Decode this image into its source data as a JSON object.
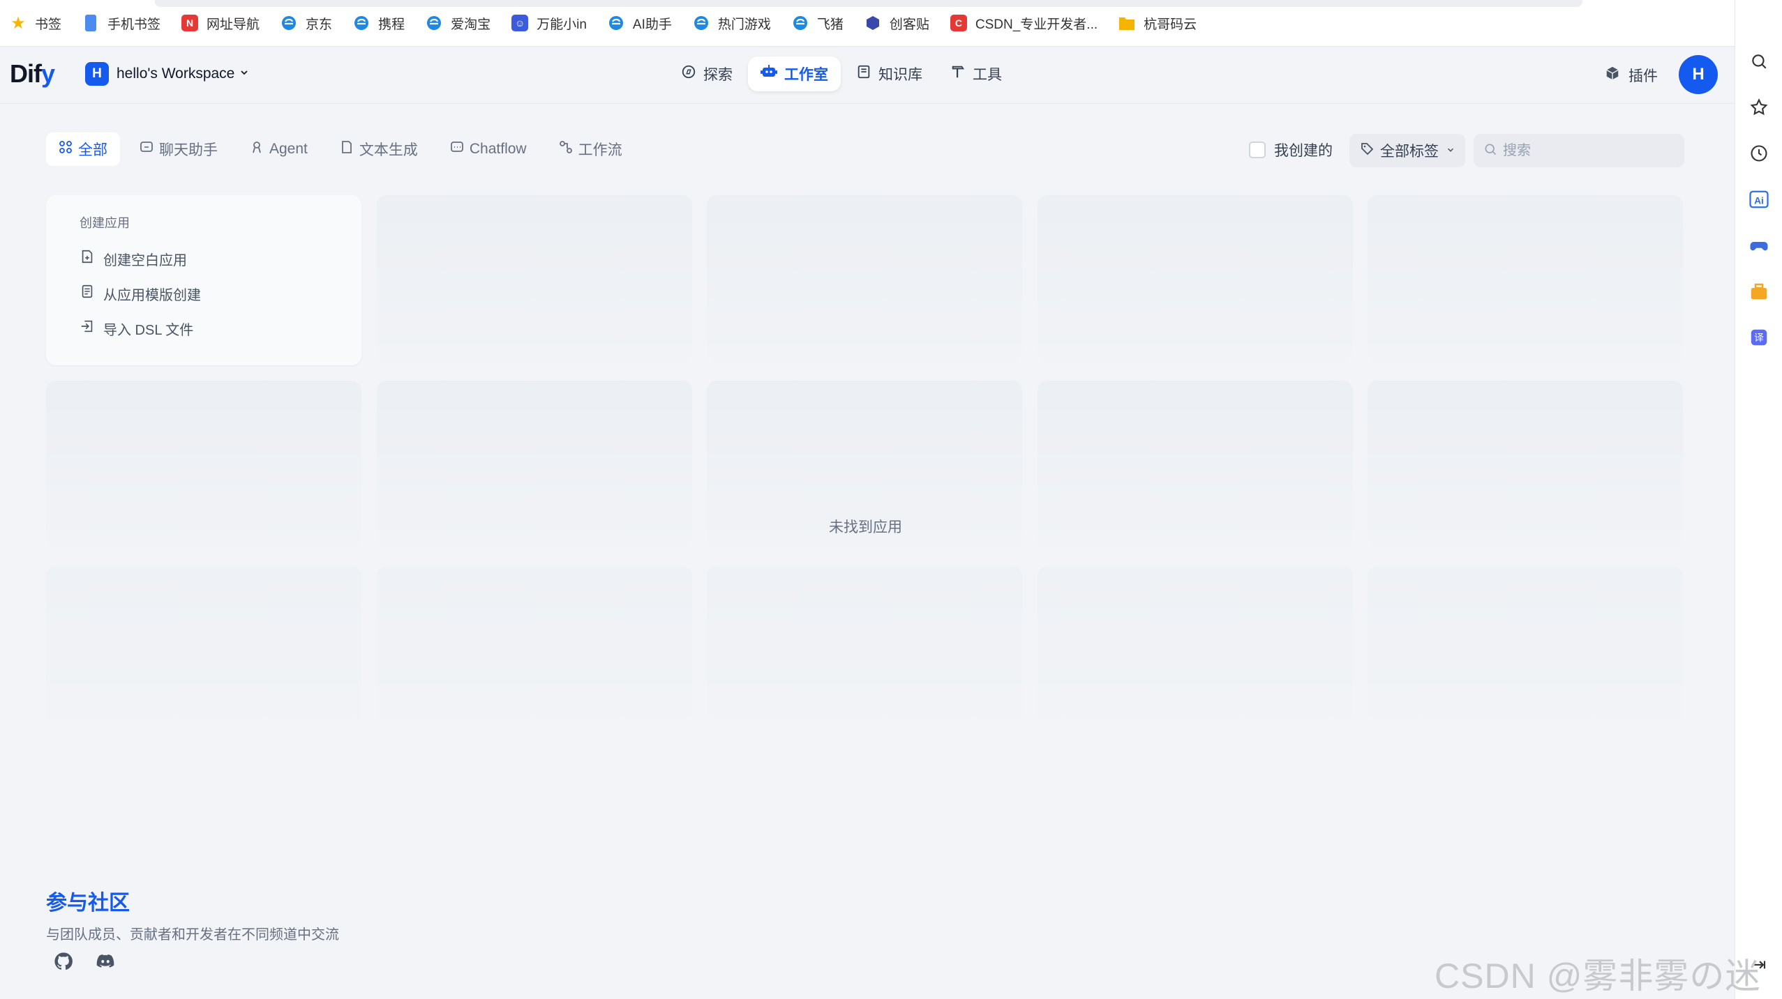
{
  "bookmarks": [
    {
      "label": "书签",
      "icon": "star-icon",
      "color": "#f7b500"
    },
    {
      "label": "手机书签",
      "icon": "phone-icon",
      "color": "#4a8cf0"
    },
    {
      "label": "网址导航",
      "icon": "nav-icon",
      "color": "#e53935"
    },
    {
      "label": "京东",
      "icon": "ie-icon",
      "color": "#1e88e5"
    },
    {
      "label": "携程",
      "icon": "ie-icon",
      "color": "#1e88e5"
    },
    {
      "label": "爱淘宝",
      "icon": "ie-icon",
      "color": "#1e88e5"
    },
    {
      "label": "万能小in",
      "icon": "robot-icon",
      "color": "#3b5bdb"
    },
    {
      "label": "AI助手",
      "icon": "ie-icon",
      "color": "#1e88e5"
    },
    {
      "label": "热门游戏",
      "icon": "ie-icon",
      "color": "#1e88e5"
    },
    {
      "label": "飞猪",
      "icon": "ie-icon",
      "color": "#1e88e5"
    },
    {
      "label": "创客贴",
      "icon": "cube-icon",
      "color": "#3949ab"
    },
    {
      "label": "CSDN_专业开发者...",
      "icon": "csdn-icon",
      "color": "#e53935"
    },
    {
      "label": "杭哥码云",
      "icon": "folder-icon",
      "color": "#f5b400"
    }
  ],
  "header": {
    "logo_prefix": "Dif",
    "logo_suffix": "y",
    "workspace_initial": "H",
    "workspace_name": "hello's Workspace",
    "nav": [
      {
        "label": "探索",
        "icon": "compass-icon",
        "active": false
      },
      {
        "label": "工作室",
        "icon": "robot-icon",
        "active": true
      },
      {
        "label": "知识库",
        "icon": "book-icon",
        "active": false
      },
      {
        "label": "工具",
        "icon": "hammer-icon",
        "active": false
      }
    ],
    "plugins_label": "插件",
    "user_initial": "H"
  },
  "filters": {
    "tabs": [
      {
        "label": "全部",
        "icon": "grid-icon",
        "active": true
      },
      {
        "label": "聊天助手",
        "icon": "chat-icon",
        "active": false
      },
      {
        "label": "Agent",
        "icon": "agent-icon",
        "active": false
      },
      {
        "label": "文本生成",
        "icon": "doc-icon",
        "active": false
      },
      {
        "label": "Chatflow",
        "icon": "chat-icon",
        "active": false
      },
      {
        "label": "工作流",
        "icon": "workflow-icon",
        "active": false
      }
    ],
    "mine_label": "我创建的",
    "tag_label": "全部标签",
    "search_placeholder": "搜索"
  },
  "create_card": {
    "title": "创建应用",
    "items": [
      {
        "label": "创建空白应用",
        "icon": "file-plus-icon"
      },
      {
        "label": "从应用模版创建",
        "icon": "template-icon"
      },
      {
        "label": "导入 DSL 文件",
        "icon": "import-icon"
      }
    ]
  },
  "empty_text": "未找到应用",
  "community": {
    "title": "参与社区",
    "desc": "与团队成员、贡献者和开发者在不同频道中交流"
  },
  "watermark": "CSDN @雾非雾の迷惘",
  "colors": {
    "accent": "#155aef",
    "bg": "#f2f4f7"
  }
}
